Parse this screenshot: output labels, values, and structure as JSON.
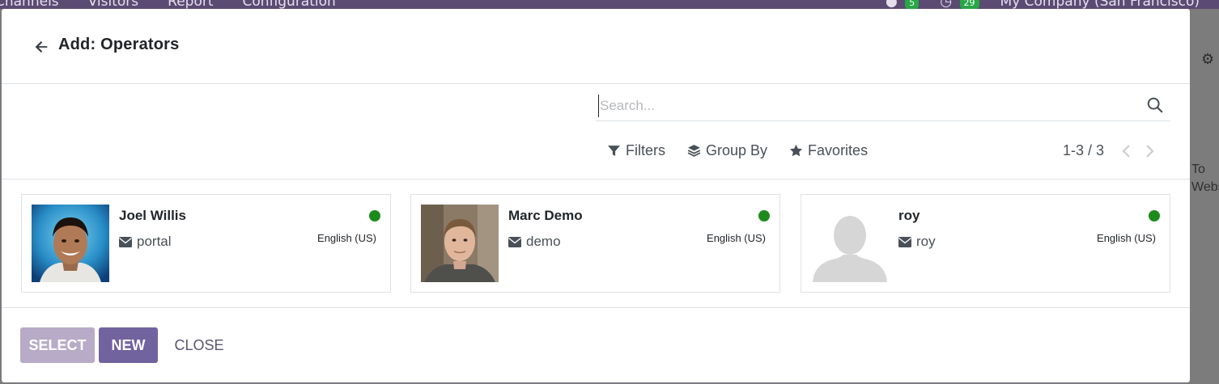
{
  "background": {
    "menu": [
      "Channels",
      "Visitors",
      "Report",
      "Configuration"
    ],
    "chat_count": "5",
    "activity_count": "29",
    "company": "My Company (San Francisco)",
    "side_text_lines": [
      "To",
      "Websit"
    ]
  },
  "dialog": {
    "title": "Add: Operators",
    "search_placeholder": "Search...",
    "filters_label": "Filters",
    "group_by_label": "Group By",
    "favorites_label": "Favorites",
    "pager_value": "1-3 / 3"
  },
  "operators": [
    {
      "name": "Joel Willis",
      "login": "portal",
      "language": "English (US)",
      "status": "online",
      "avatar": "photo-joel"
    },
    {
      "name": "Marc Demo",
      "login": "demo",
      "language": "English (US)",
      "status": "online",
      "avatar": "photo-marc"
    },
    {
      "name": "roy",
      "login": "roy",
      "language": "English (US)",
      "status": "online",
      "avatar": "placeholder-silhouette"
    }
  ],
  "footer": {
    "select_label": "SELECT",
    "new_label": "NEW",
    "close_label": "CLOSE"
  },
  "colors": {
    "primary": "#71639e",
    "primary_disabled": "#b7abc7",
    "online": "#1d8a1d",
    "topbar": "#5b4b73"
  }
}
